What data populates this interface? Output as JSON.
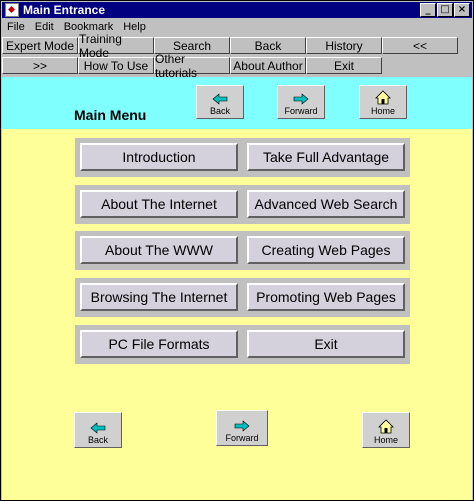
{
  "window": {
    "title": "Main Entrance",
    "controls": [
      "_",
      "□",
      "×"
    ]
  },
  "menubar": [
    "File",
    "Edit",
    "Bookmark",
    "Help"
  ],
  "nav_row1": [
    "Expert Mode",
    "Training Mode",
    "Search",
    "Back",
    "History",
    "<<"
  ],
  "nav_row2": [
    ">>",
    "How To Use",
    "Other tutorials",
    "About Author",
    "Exit"
  ],
  "header": {
    "title": "Main Menu",
    "buttons": {
      "back": "Back",
      "forward": "Forward",
      "home": "Home"
    }
  },
  "menu": [
    [
      "Introduction",
      "Take Full Advantage"
    ],
    [
      "About The Internet",
      "Advanced Web Search"
    ],
    [
      "About The WWW",
      "Creating Web Pages"
    ],
    [
      "Browsing The Internet",
      "Promoting Web Pages"
    ],
    [
      "PC File Formats",
      "Exit"
    ]
  ],
  "footer": {
    "back": "Back",
    "forward": "Forward",
    "home": "Home"
  },
  "colors": {
    "titlebar": "#000080",
    "header_bg": "#80ffff",
    "content_bg": "#ffff99",
    "arrow": "#00c0c0"
  }
}
